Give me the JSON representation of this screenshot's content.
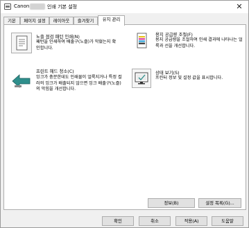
{
  "window": {
    "title_left": "Canon",
    "title_right": "인쇄 기본 설정",
    "close_glyph": "✕"
  },
  "tabs": [
    {
      "label": "기본"
    },
    {
      "label": "페이지 설정"
    },
    {
      "label": "레이아웃"
    },
    {
      "label": "즐겨찾기"
    },
    {
      "label": "유지 관리"
    }
  ],
  "functions": {
    "nozzle_check": {
      "title": "노즐 점검 패턴 인쇄(N)",
      "desc": "패턴을 인쇄하여 배출구(노즐)가 막혔는지 확인합니다.",
      "icon": "nozzle-pattern-icon"
    },
    "paper_feed_adjust": {
      "title": "용지 공급량 조절(F)",
      "desc": "용지 공급량을 조절하여 인쇄 결과에 나타나는 얼룩과 선을 개선합니다.",
      "icon": "paper-feed-icon"
    },
    "head_cleaning": {
      "title": "프린트 헤드 청소(C)",
      "desc": "잉크가 충분한데도 인쇄물이 얼룩지거나 특정 컬러의 잉크가 배출되지 않으면 잉크 배출구(노즐)의 막힘을 개선합니다.",
      "icon": "head-cleaning-icon"
    },
    "status_view": {
      "title": "상태 보기(S)",
      "desc": "프린터 정보 및 설정 값을 표시합니다.",
      "icon": "status-monitor-icon"
    }
  },
  "panel_buttons": {
    "info": "정보(B)",
    "settings_list": "설정 목록(G)..."
  },
  "footer": {
    "ok": "확인",
    "cancel": "취소",
    "apply": "적용(A)",
    "help": "도움말"
  },
  "colors": {
    "accent_teal": "#2f8f8c",
    "window_bg": "#f0f0f0",
    "panel_bg": "#ffffff"
  }
}
